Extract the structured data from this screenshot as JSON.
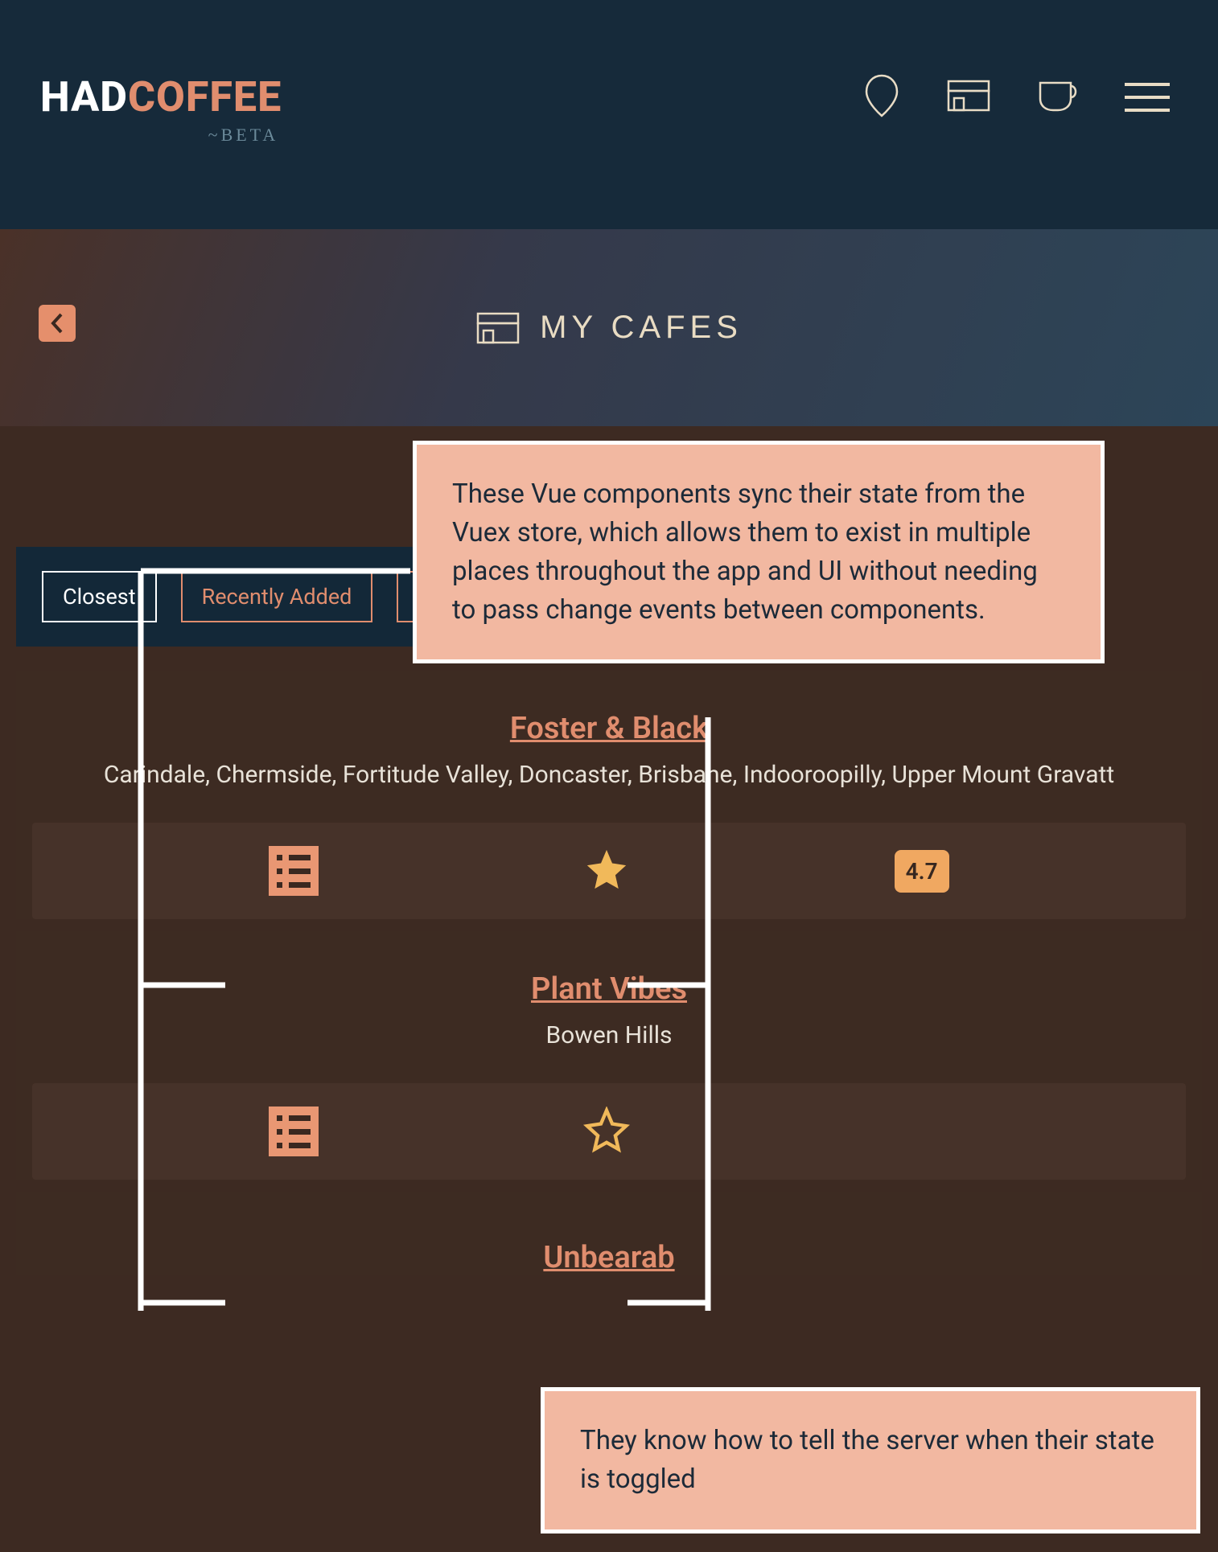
{
  "header": {
    "logo_had": "HAD",
    "logo_coffee": "COFFEE",
    "logo_beta": "~BETA"
  },
  "subheader": {
    "title": "MY CAFES"
  },
  "tabs": {
    "closest": "Closest",
    "recently_added": "Recently Added",
    "third": ""
  },
  "cafes": [
    {
      "name": "Foster & Black",
      "locations": "Carindale, Chermside, Fortitude Valley, Doncaster, Brisbane, Indooroopilly, Upper Mount Gravatt",
      "starred": true,
      "rating": "4.7"
    },
    {
      "name": "Plant Vibes",
      "locations": "Bowen Hills",
      "starred": false,
      "rating": null
    },
    {
      "name": "Unbearab",
      "locations": "",
      "starred": false,
      "rating": null
    }
  ],
  "annotations": {
    "a1": "These Vue components sync their state from the Vuex store, which allows them to exist in multiple places throughout the app and UI without needing to pass change events between components.",
    "a2": "They know how to tell the server when their state is toggled"
  },
  "colors": {
    "accent": "#e08d6e",
    "header_bg": "#162a3a",
    "body_bg": "#3d2a22",
    "annotation_bg": "#f2b8a1"
  }
}
